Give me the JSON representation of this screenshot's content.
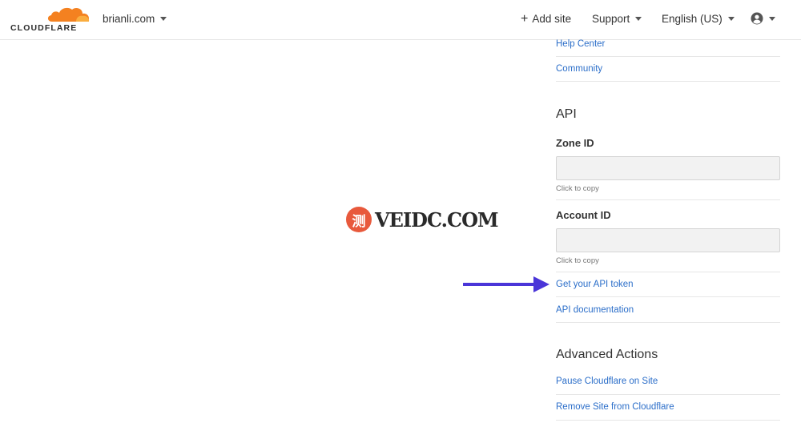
{
  "header": {
    "logo_text": "CLOUDFLARE",
    "domain": "brianli.com",
    "add_site": "Add site",
    "support": "Support",
    "language": "English (US)",
    "icons": [
      "cloud-logo-icon",
      "caret-down-icon",
      "plus-icon",
      "user-circle-icon"
    ]
  },
  "panel": {
    "links_top": [
      "Help Center",
      "Community"
    ],
    "api": {
      "title": "API",
      "zone_id_label": "Zone ID",
      "zone_id_value": "",
      "zone_id_hint": "Click to copy",
      "account_id_label": "Account ID",
      "account_id_value": "",
      "account_id_hint": "Click to copy",
      "links": [
        "Get your API token",
        "API documentation"
      ]
    },
    "advanced": {
      "title": "Advanced Actions",
      "links": [
        "Pause Cloudflare on Site",
        "Remove Site from Cloudflare"
      ]
    }
  },
  "watermark": {
    "badge": "测",
    "text": "VEIDC.COM"
  },
  "colors": {
    "brand_orange": "#f48120",
    "brand_orange_light": "#faad3f",
    "link": "#2b6ec9",
    "arrow": "#4a35d8",
    "watermark_badge": "#e8593c"
  }
}
